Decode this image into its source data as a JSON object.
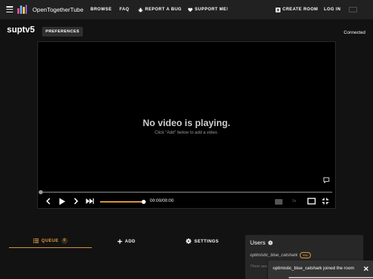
{
  "navbar": {
    "brand": "OpenTogetherTube",
    "links": [
      "Browse",
      "FAQ",
      "Report a Bug",
      "Support Me!"
    ],
    "create_room": "Create Room",
    "login": "Log In"
  },
  "room": {
    "title": "suptv5",
    "preferences_label": "Preferences",
    "connection_status": "Connected"
  },
  "player": {
    "empty_title": "No video is playing.",
    "empty_hint": "Click \"Add\" below to add a video.",
    "timestamp": "00:00/00:00",
    "playback_speed": "1x",
    "progress": 0,
    "volume": 1.0
  },
  "tabs": {
    "queue": "Queue",
    "queue_count": "0",
    "add": "Add",
    "settings": "Settings"
  },
  "users": {
    "title": "Users",
    "list": [
      {
        "name": "optimistic_blue_catshark",
        "badge": "You"
      }
    ],
    "note": "There see..."
  },
  "toast": {
    "message": "optimistic_blue_catshark joined the room"
  },
  "colors": {
    "accent": "#e39f3c",
    "background": "#121212",
    "navbar": "#212121",
    "panel": "#272727"
  }
}
